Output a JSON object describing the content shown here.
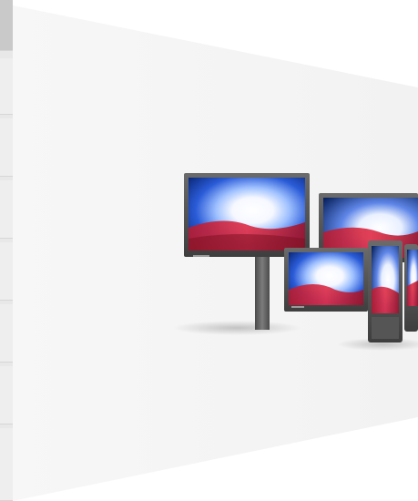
{
  "image": {
    "icon": "digital-signage-displays-image",
    "accent_colors": [
      "#d9243c",
      "#2a5bd7",
      "#ffffff"
    ],
    "panel_color": "#f5f5f5"
  }
}
